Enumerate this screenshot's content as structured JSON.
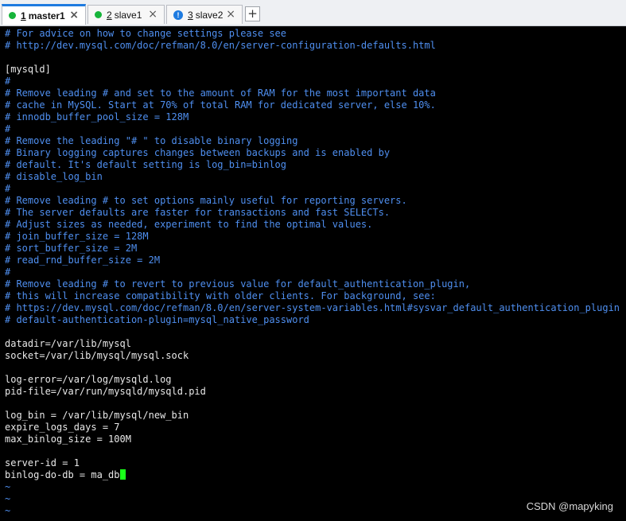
{
  "tabs": [
    {
      "num": "1",
      "label": "master1",
      "status": "green",
      "active": true
    },
    {
      "num": "2",
      "label": "slave1",
      "status": "green",
      "active": false
    },
    {
      "num": "3",
      "label": "slave2",
      "status": "info",
      "active": false
    }
  ],
  "tab_close_glyph": "×",
  "new_tab_glyph": "+",
  "info_glyph": "!",
  "terminal": {
    "lines": [
      {
        "t": "# For advice on how to change settings please see",
        "k": "comment"
      },
      {
        "t": "# http://dev.mysql.com/doc/refman/8.0/en/server-configuration-defaults.html",
        "k": "comment"
      },
      {
        "t": "",
        "k": "text"
      },
      {
        "t": "[mysqld]",
        "k": "text"
      },
      {
        "t": "#",
        "k": "comment"
      },
      {
        "t": "# Remove leading # and set to the amount of RAM for the most important data",
        "k": "comment"
      },
      {
        "t": "# cache in MySQL. Start at 70% of total RAM for dedicated server, else 10%.",
        "k": "comment"
      },
      {
        "t": "# innodb_buffer_pool_size = 128M",
        "k": "comment"
      },
      {
        "t": "#",
        "k": "comment"
      },
      {
        "t": "# Remove the leading \"# \" to disable binary logging",
        "k": "comment"
      },
      {
        "t": "# Binary logging captures changes between backups and is enabled by",
        "k": "comment"
      },
      {
        "t": "# default. It's default setting is log_bin=binlog",
        "k": "comment"
      },
      {
        "t": "# disable_log_bin",
        "k": "comment"
      },
      {
        "t": "#",
        "k": "comment"
      },
      {
        "t": "# Remove leading # to set options mainly useful for reporting servers.",
        "k": "comment"
      },
      {
        "t": "# The server defaults are faster for transactions and fast SELECTs.",
        "k": "comment"
      },
      {
        "t": "# Adjust sizes as needed, experiment to find the optimal values.",
        "k": "comment"
      },
      {
        "t": "# join_buffer_size = 128M",
        "k": "comment"
      },
      {
        "t": "# sort_buffer_size = 2M",
        "k": "comment"
      },
      {
        "t": "# read_rnd_buffer_size = 2M",
        "k": "comment"
      },
      {
        "t": "#",
        "k": "comment"
      },
      {
        "t": "# Remove leading # to revert to previous value for default_authentication_plugin,",
        "k": "comment"
      },
      {
        "t": "# this will increase compatibility with older clients. For background, see:",
        "k": "comment"
      },
      {
        "t": "# https://dev.mysql.com/doc/refman/8.0/en/server-system-variables.html#sysvar_default_authentication_plugin",
        "k": "comment"
      },
      {
        "t": "# default-authentication-plugin=mysql_native_password",
        "k": "comment"
      },
      {
        "t": "",
        "k": "text"
      },
      {
        "t": "datadir=/var/lib/mysql",
        "k": "text"
      },
      {
        "t": "socket=/var/lib/mysql/mysql.sock",
        "k": "text"
      },
      {
        "t": "",
        "k": "text"
      },
      {
        "t": "log-error=/var/log/mysqld.log",
        "k": "text"
      },
      {
        "t": "pid-file=/var/run/mysqld/mysqld.pid",
        "k": "text"
      },
      {
        "t": "",
        "k": "text"
      },
      {
        "t": "log_bin = /var/lib/mysql/new_bin",
        "k": "text"
      },
      {
        "t": "expire_logs_days = 7",
        "k": "text"
      },
      {
        "t": "max_binlog_size = 100M",
        "k": "text"
      },
      {
        "t": "",
        "k": "text"
      },
      {
        "t": "server-id = 1",
        "k": "text"
      },
      {
        "t": "binlog-do-db = ma_db",
        "k": "text",
        "cursor": true
      },
      {
        "t": "~",
        "k": "tilde"
      },
      {
        "t": "~",
        "k": "tilde"
      },
      {
        "t": "~",
        "k": "tilde"
      }
    ]
  },
  "watermark": "CSDN @mapyking",
  "colors": {
    "comment": "#4f8ff0",
    "text": "#e8e8e8",
    "cursor": "#19ff19",
    "active_tab_accent": "#1e7be0",
    "status_green": "#16b43a"
  }
}
